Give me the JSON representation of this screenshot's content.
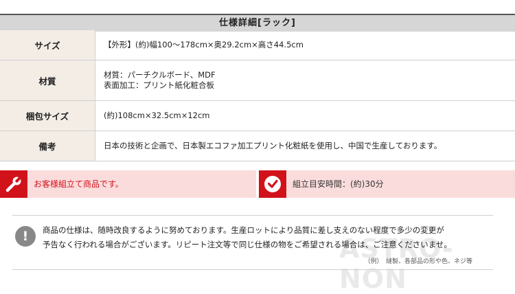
{
  "spec": {
    "title": "仕様詳細[ラック]",
    "rows": [
      {
        "label": "サイズ",
        "lines": [
          "【外形】(約)幅100〜178cm×奥29.2cm×高さ44.5cm"
        ]
      },
      {
        "label": "材質",
        "lines": [
          "材質：パーチクルボード、MDF",
          "表面加工：プリント紙化粧合板"
        ]
      },
      {
        "label": "梱包サイズ",
        "lines": [
          "(約)108cm×32.5cm×12cm"
        ]
      },
      {
        "label": "備考",
        "lines": [
          "日本の技術と企画で、日本製エコファ加工プリント化粧紙を使用し、中国で生産しております。"
        ]
      }
    ]
  },
  "assembly": {
    "left_text": "お客様組立て商品です。",
    "right_text": "組立目安時間：(約)30分",
    "left_icon": "wrench-icon",
    "right_icon": "clock-icon",
    "accent_color": "#d2121a",
    "strip_color": "#fbdcdc"
  },
  "notice": {
    "icon_glyph": "!",
    "line1": "商品の仕様は、随時改良するように努めております。生産ロットにより品質に差し支えのない程度で多少の変更が",
    "line2": "予告なく行われる場合がございます。リピート注文等で同じ仕様の物をご希望される場合は、ご注意くださいませ。",
    "example": "（例）　縫製、各部品の形や色、ネジ等"
  },
  "watermark": "ASTRO-NON"
}
